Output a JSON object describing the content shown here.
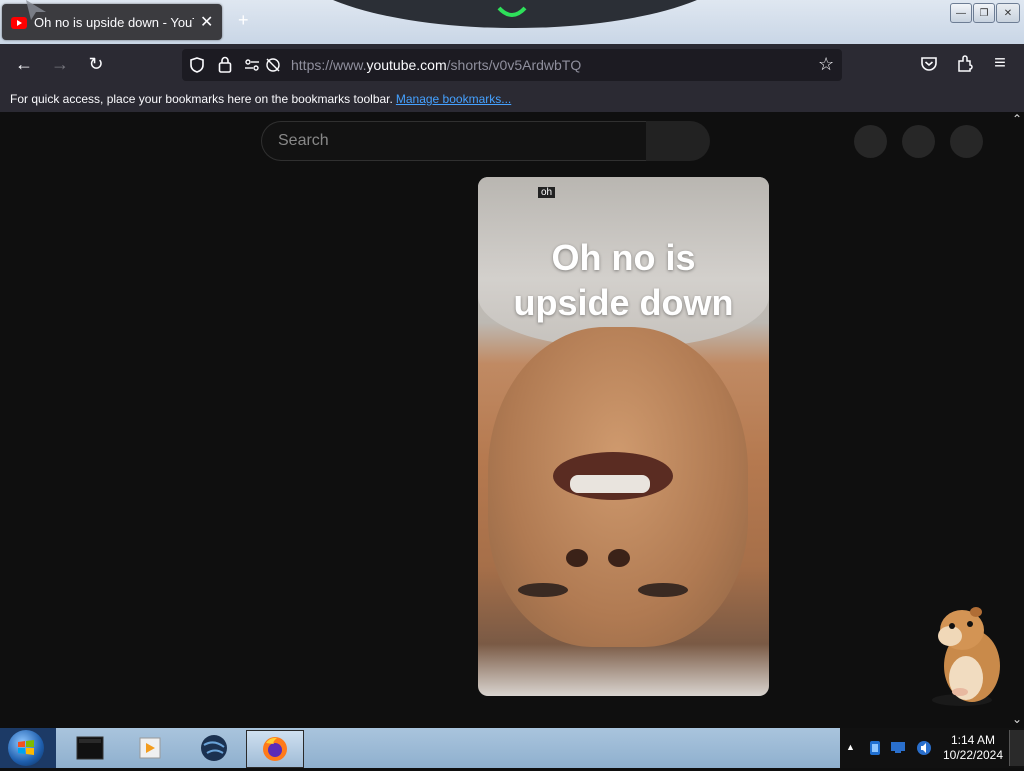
{
  "browser": {
    "tab_title": "Oh no is upside down - YouTube",
    "tab_close": "✕",
    "new_tab": "+",
    "url_prefix": "https://www.",
    "url_domain": "youtube.com",
    "url_path": "/shorts/v0v5ArdwbTQ",
    "bookmarks_text": "For quick access, place your bookmarks here on the bookmarks toolbar.",
    "bookmarks_link": "Manage bookmarks..."
  },
  "youtube": {
    "search_placeholder": "Search",
    "short": {
      "caption_line1": "Oh no is",
      "caption_line2": "upside down",
      "corner_tag": "oh"
    }
  },
  "taskbar": {
    "clock_time": "1:14 AM",
    "clock_date": "10/22/2024",
    "tray_expand": "▲"
  },
  "icons": {
    "back": "←",
    "forward": "→",
    "reload": "↻",
    "star": "☆",
    "pocket": "pocket-icon",
    "extensions": "puzzle-icon",
    "menu": "≡"
  },
  "colors": {
    "youtube_red": "#ff0000",
    "link": "#45a1ff",
    "page_bg": "#0f0f0f"
  }
}
